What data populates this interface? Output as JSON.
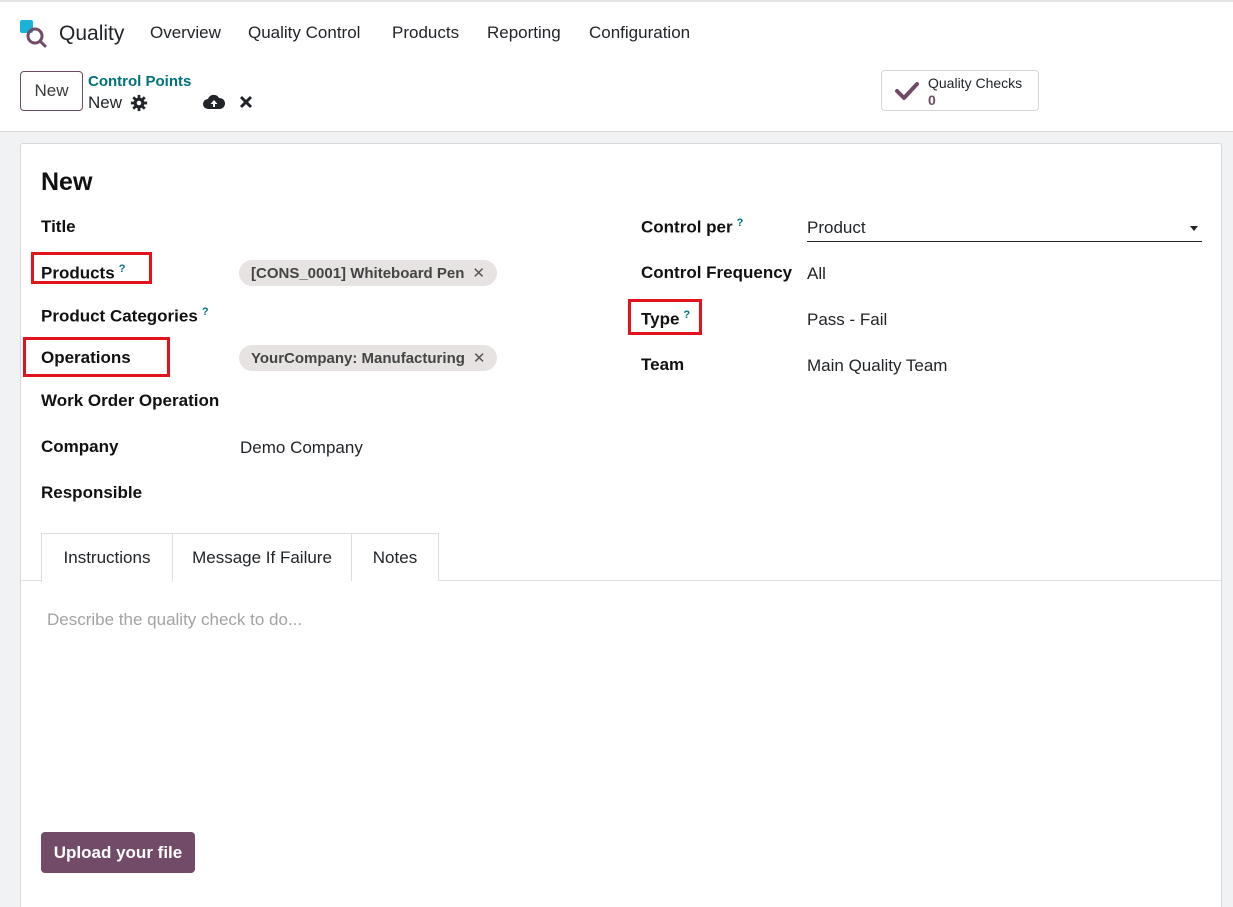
{
  "navbar": {
    "app_name": "Quality",
    "items": [
      "Overview",
      "Quality Control",
      "Products",
      "Reporting",
      "Configuration"
    ]
  },
  "control_panel": {
    "new_label": "New",
    "breadcrumb_parent": "Control Points",
    "breadcrumb_current": "New",
    "smart_button": {
      "label": "Quality Checks",
      "value": "0"
    }
  },
  "form": {
    "title": "New",
    "left_fields": {
      "title_label": "Title",
      "products_label": "Products",
      "products_tag": "[CONS_0001] Whiteboard Pen",
      "product_categories_label": "Product Categories",
      "operations_label": "Operations",
      "operations_tag": "YourCompany: Manufacturing",
      "work_order_operation_label": "Work Order Operation",
      "company_label": "Company",
      "company_value": "Demo Company",
      "responsible_label": "Responsible"
    },
    "right_fields": {
      "control_per_label": "Control per",
      "control_per_value": "Product",
      "control_frequency_label": "Control Frequency",
      "control_frequency_value": "All",
      "type_label": "Type",
      "type_value": "Pass - Fail",
      "team_label": "Team",
      "team_value": "Main Quality Team"
    },
    "help_marker": "?",
    "tag_remove": "✕"
  },
  "tabs": [
    "Instructions",
    "Message If Failure",
    "Notes"
  ],
  "instructions_placeholder": "Describe the quality check to do...",
  "upload_label": "Upload your file",
  "colors": {
    "accent": "#714b67",
    "link": "#01717a",
    "highlight": "#e3131e"
  }
}
